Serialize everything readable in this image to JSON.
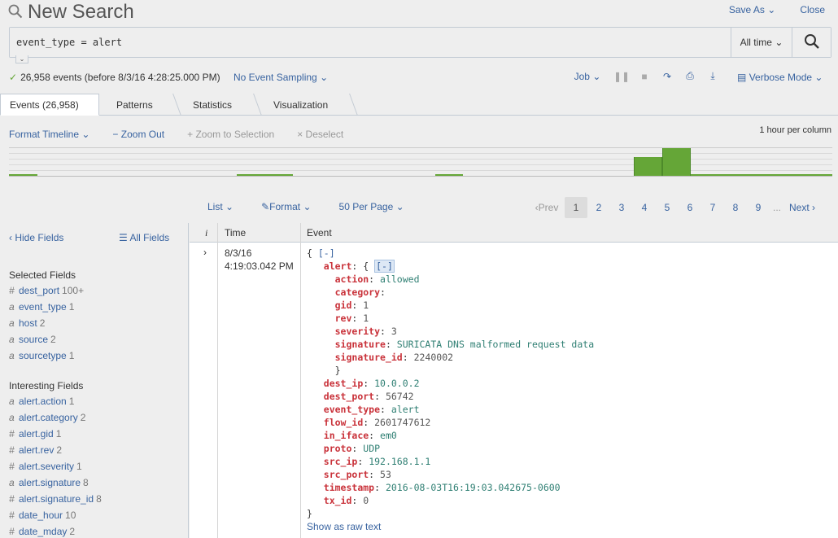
{
  "header": {
    "title": "New Search",
    "save_as": "Save As",
    "close": "Close"
  },
  "search": {
    "query": "event_type = alert",
    "time_range": "All time"
  },
  "status": {
    "events_text": "26,958 events (before 8/3/16 4:28:25.000 PM)",
    "sampling": "No Event Sampling",
    "job": "Job",
    "mode": "Verbose Mode"
  },
  "tabs": [
    {
      "label": "Events (26,958)"
    },
    {
      "label": "Patterns"
    },
    {
      "label": "Statistics"
    },
    {
      "label": "Visualization"
    }
  ],
  "timeline": {
    "format": "Format Timeline",
    "zoom_out": "Zoom Out",
    "zoom_selection": "Zoom to Selection",
    "deselect": "Deselect",
    "per_column": "1 hour per column"
  },
  "results_controls": {
    "list": "List",
    "format": "Format",
    "per_page": "50 Per Page"
  },
  "pager": {
    "prev": "Prev",
    "pages": [
      "1",
      "2",
      "3",
      "4",
      "5",
      "6",
      "7",
      "8",
      "9"
    ],
    "ellipsis": "...",
    "next": "Next"
  },
  "sidebar": {
    "hide_fields": "Hide Fields",
    "all_fields": "All Fields",
    "selected_title": "Selected Fields",
    "selected": [
      {
        "type": "#",
        "name": "dest_port",
        "count": "100+"
      },
      {
        "type": "a",
        "name": "event_type",
        "count": "1"
      },
      {
        "type": "a",
        "name": "host",
        "count": "2"
      },
      {
        "type": "a",
        "name": "source",
        "count": "2"
      },
      {
        "type": "a",
        "name": "sourcetype",
        "count": "1"
      }
    ],
    "interesting_title": "Interesting Fields",
    "interesting": [
      {
        "type": "a",
        "name": "alert.action",
        "count": "1"
      },
      {
        "type": "a",
        "name": "alert.category",
        "count": "2"
      },
      {
        "type": "#",
        "name": "alert.gid",
        "count": "1"
      },
      {
        "type": "#",
        "name": "alert.rev",
        "count": "2"
      },
      {
        "type": "#",
        "name": "alert.severity",
        "count": "1"
      },
      {
        "type": "a",
        "name": "alert.signature",
        "count": "8"
      },
      {
        "type": "#",
        "name": "alert.signature_id",
        "count": "8"
      },
      {
        "type": "#",
        "name": "date_hour",
        "count": "10"
      },
      {
        "type": "#",
        "name": "date_mday",
        "count": "2"
      }
    ]
  },
  "results_head": {
    "info": "i",
    "time": "Time",
    "event": "Event"
  },
  "event": {
    "date": "8/3/16",
    "time": "4:19:03.042 PM",
    "collapse": "[-]",
    "alert_key": "alert",
    "alert_fields": [
      {
        "key": "action",
        "value": "allowed",
        "kind": "str"
      },
      {
        "key": "category",
        "value": "",
        "kind": "str"
      },
      {
        "key": "gid",
        "value": "1",
        "kind": "num"
      },
      {
        "key": "rev",
        "value": "1",
        "kind": "num"
      },
      {
        "key": "severity",
        "value": "3",
        "kind": "num"
      },
      {
        "key": "signature",
        "value": "SURICATA DNS malformed request data",
        "kind": "str"
      },
      {
        "key": "signature_id",
        "value": "2240002",
        "kind": "num"
      }
    ],
    "fields": [
      {
        "key": "dest_ip",
        "value": "10.0.0.2",
        "kind": "str"
      },
      {
        "key": "dest_port",
        "value": "56742",
        "kind": "num"
      },
      {
        "key": "event_type",
        "value": "alert",
        "kind": "str"
      },
      {
        "key": "flow_id",
        "value": "2601747612",
        "kind": "num"
      },
      {
        "key": "in_iface",
        "value": "em0",
        "kind": "str"
      },
      {
        "key": "proto",
        "value": "UDP",
        "kind": "str"
      },
      {
        "key": "src_ip",
        "value": "192.168.1.1",
        "kind": "str"
      },
      {
        "key": "src_port",
        "value": "53",
        "kind": "num"
      },
      {
        "key": "timestamp",
        "value": "2016-08-03T16:19:03.042675-0600",
        "kind": "str"
      },
      {
        "key": "tx_id",
        "value": "0",
        "kind": "num"
      }
    ],
    "show_raw": "Show as raw text"
  },
  "colors": {
    "link": "#3863a0",
    "bar": "#65a637",
    "key": "#c9323a",
    "value": "#2f7f73"
  }
}
